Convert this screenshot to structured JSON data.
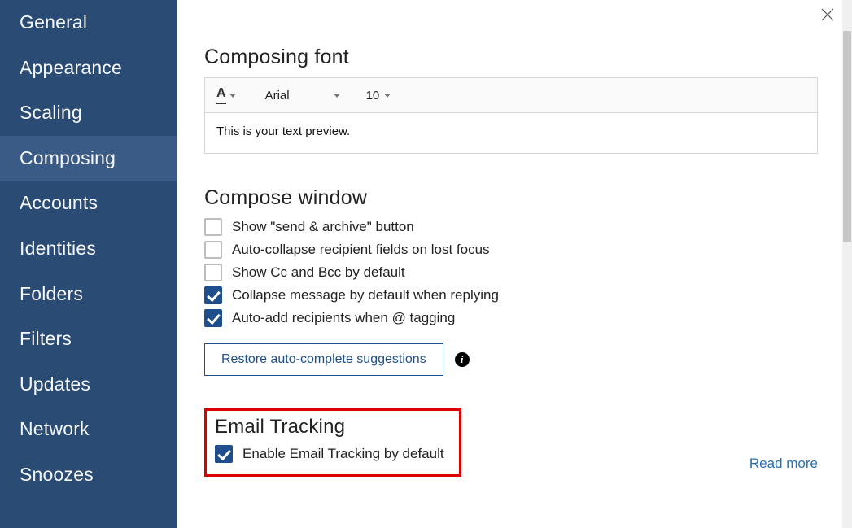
{
  "sidebar": {
    "items": [
      {
        "label": "General"
      },
      {
        "label": "Appearance"
      },
      {
        "label": "Scaling"
      },
      {
        "label": "Composing"
      },
      {
        "label": "Accounts"
      },
      {
        "label": "Identities"
      },
      {
        "label": "Folders"
      },
      {
        "label": "Filters"
      },
      {
        "label": "Updates"
      },
      {
        "label": "Network"
      },
      {
        "label": "Snoozes"
      }
    ],
    "activeIndex": 3
  },
  "composingFont": {
    "heading": "Composing font",
    "family": "Arial",
    "size": "10",
    "previewText": "This is your text preview."
  },
  "composeWindow": {
    "heading": "Compose window",
    "options": [
      {
        "label": "Show \"send & archive\" button",
        "checked": false
      },
      {
        "label": "Auto-collapse recipient fields on lost focus",
        "checked": false
      },
      {
        "label": "Show Cc and Bcc by default",
        "checked": false
      },
      {
        "label": "Collapse message by default when replying",
        "checked": true
      },
      {
        "label": "Auto-add recipients when @ tagging",
        "checked": true
      }
    ],
    "restoreButton": "Restore auto-complete suggestions"
  },
  "emailTracking": {
    "heading": "Email Tracking",
    "option": {
      "label": "Enable Email Tracking by default",
      "checked": true
    },
    "readMore": "Read more"
  }
}
